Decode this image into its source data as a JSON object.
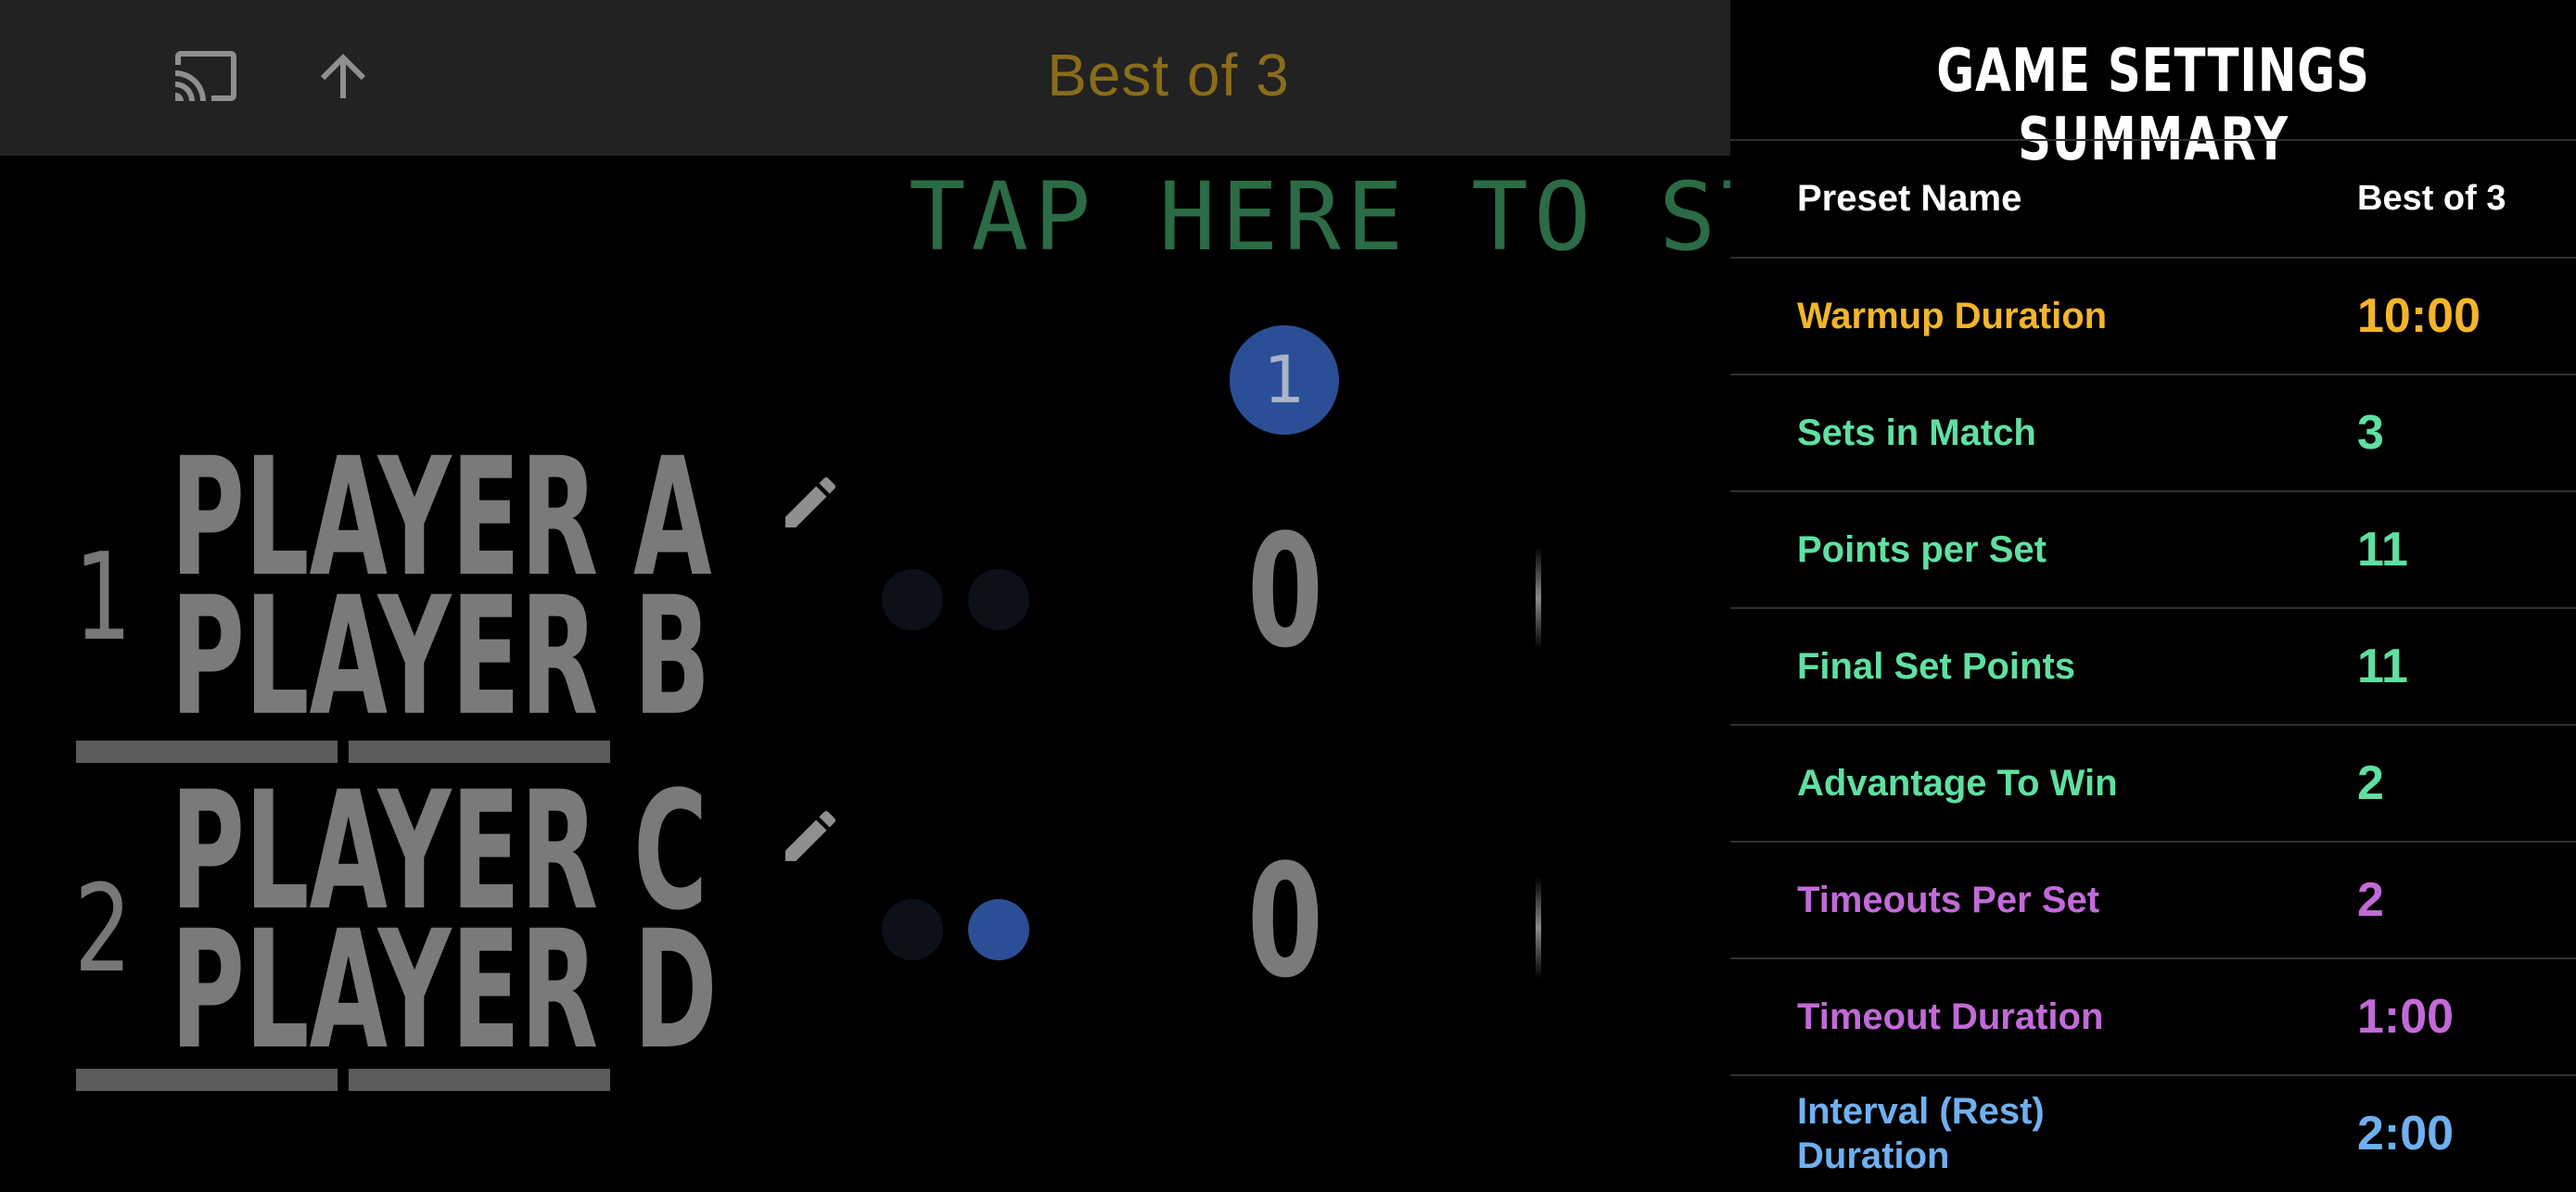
{
  "header": {
    "title": "Best of 3",
    "icons": [
      "cast-icon",
      "upload-icon"
    ]
  },
  "start_banner": "TAP HERE TO START",
  "current_set": "1",
  "teams": [
    {
      "number": "1",
      "players": [
        "PLAYER A",
        "PLAYER B"
      ],
      "score": "0",
      "timeouts_used": 0
    },
    {
      "number": "2",
      "players": [
        "PLAYER C",
        "PLAYER D"
      ],
      "score": "0",
      "timeouts_used": 1
    }
  ],
  "summary": {
    "title": "GAME SETTINGS SUMMARY",
    "rows": [
      {
        "label": "Preset Name",
        "value": "Best of 3",
        "color": "#ffffff"
      },
      {
        "label": "Warmup Duration",
        "value": "10:00",
        "color": "#f4b528"
      },
      {
        "label": "Sets in Match",
        "value": "3",
        "color": "#5fe0a2"
      },
      {
        "label": "Points per Set",
        "value": "11",
        "color": "#5fe0a2"
      },
      {
        "label": "Final Set Points",
        "value": "11",
        "color": "#5fe0a2"
      },
      {
        "label": "Advantage To Win",
        "value": "2",
        "color": "#5fe0a2"
      },
      {
        "label": "Timeouts Per Set",
        "value": "2",
        "color": "#c26ad8"
      },
      {
        "label": "Timeout Duration",
        "value": "1:00",
        "color": "#c26ad8"
      },
      {
        "label": "Interval (Rest) Duration",
        "value": "2:00",
        "color": "#6fb0f0"
      }
    ]
  },
  "colors": {
    "accent_blue": "#2b4f97",
    "title_gold": "#8a6d1a",
    "start_green": "#2b6b45"
  }
}
